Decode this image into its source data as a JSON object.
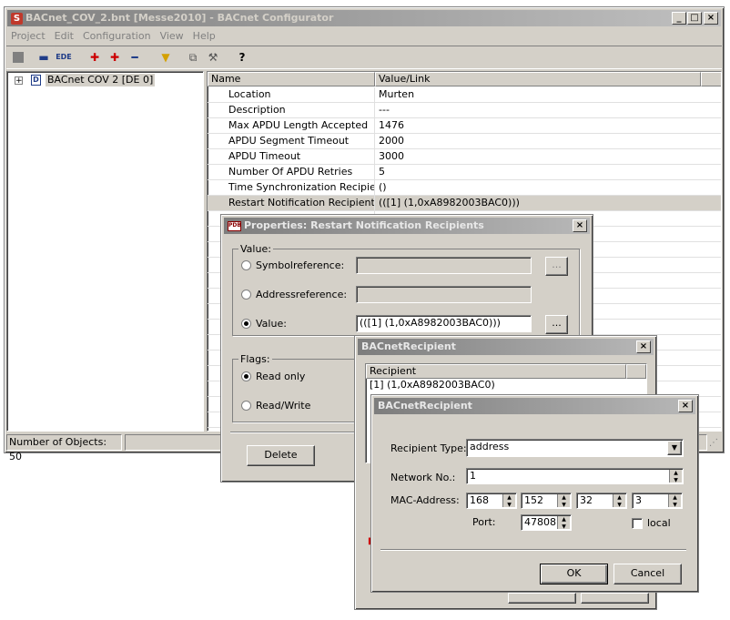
{
  "main_window": {
    "title": "BACnet_COV_2.bnt [Messe2010] - BACnet Configurator",
    "menu": [
      "Project",
      "Edit",
      "Configuration",
      "View",
      "Help"
    ],
    "tree_item": "BACnet COV 2 [DE 0]",
    "grid_headers": {
      "name": "Name",
      "value": "Value/Link"
    },
    "rows": [
      {
        "name": "Location",
        "value": "Murten"
      },
      {
        "name": "Description",
        "value": "---"
      },
      {
        "name": "Max APDU Length Accepted",
        "value": "1476"
      },
      {
        "name": "APDU Segment Timeout",
        "value": "2000"
      },
      {
        "name": "APDU Timeout",
        "value": "3000"
      },
      {
        "name": "Number Of APDU Retries",
        "value": "5"
      },
      {
        "name": "Time Synchronization Recipients",
        "value": "()"
      },
      {
        "name": "Restart Notification Recipients",
        "value": "(([1] (1,0xA8982003BAC0)))"
      }
    ],
    "status": "Number of Objects: 50"
  },
  "properties_dialog": {
    "title": "Properties: Restart Notification Recipients",
    "value_group": "Value:",
    "symbolref_label": "Symbolreference:",
    "addressref_label": "Addressreference:",
    "value_label": "Value:",
    "value_text": "(([1] (1,0xA8982003BAC0)))",
    "browse": "...",
    "flags_group": "Flags:",
    "readonly_label": "Read only",
    "readwrite_label": "Read/Write",
    "delete_button": "Delete"
  },
  "recipient_list_dialog": {
    "title": "BACnetRecipient",
    "col_header": "Recipient",
    "item": "[1] (1,0xA8982003BAC0)"
  },
  "recipient_dialog": {
    "title": "BACnetRecipient",
    "recipient_type_label": "Recipient Type:",
    "recipient_type_value": "address",
    "network_label": "Network No.:",
    "network_value": "1",
    "mac_label": "MAC-Address:",
    "mac": [
      "168",
      "152",
      "32",
      "3"
    ],
    "port_label": "Port:",
    "port_value": "47808",
    "local_label": "local",
    "ok_button": "OK",
    "cancel_button": "Cancel"
  }
}
